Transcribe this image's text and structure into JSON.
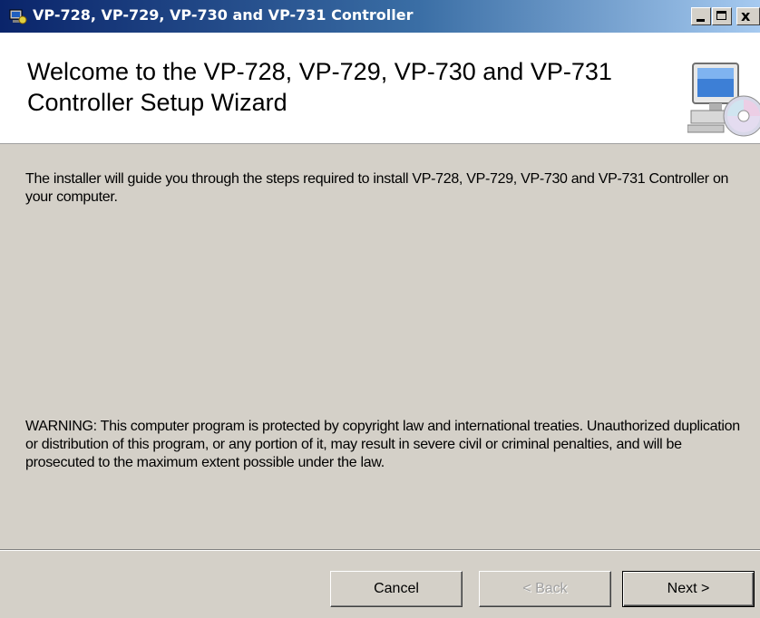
{
  "window": {
    "title": "VP-728, VP-729, VP-730 and VP-731 Controller",
    "controls": {
      "minimize_icon": "minimize-icon",
      "maximize_icon": "maximize-icon",
      "close_label": "x"
    }
  },
  "banner": {
    "title": "Welcome to the VP-728, VP-729, VP-730 and VP-731 Controller Setup Wizard",
    "icon": "computer-cd-icon"
  },
  "body": {
    "intro": "The installer will guide you through the steps required to install VP-728, VP-729, VP-730 and VP-731 Controller on your computer.",
    "warning": "WARNING: This computer program is protected by copyright law and international treaties. Unauthorized duplication or distribution of this program, or any portion of it, may result in severe civil or criminal penalties, and will be prosecuted to the maximum extent possible under the law."
  },
  "buttons": {
    "cancel": "Cancel",
    "back": "< Back",
    "next": "Next >"
  },
  "colors": {
    "titlebar_start": "#0a246a",
    "titlebar_end": "#a6caf0",
    "dialog_face": "#d4d0c8",
    "banner_bg": "#ffffff",
    "disabled_text": "#a0a0a0"
  }
}
